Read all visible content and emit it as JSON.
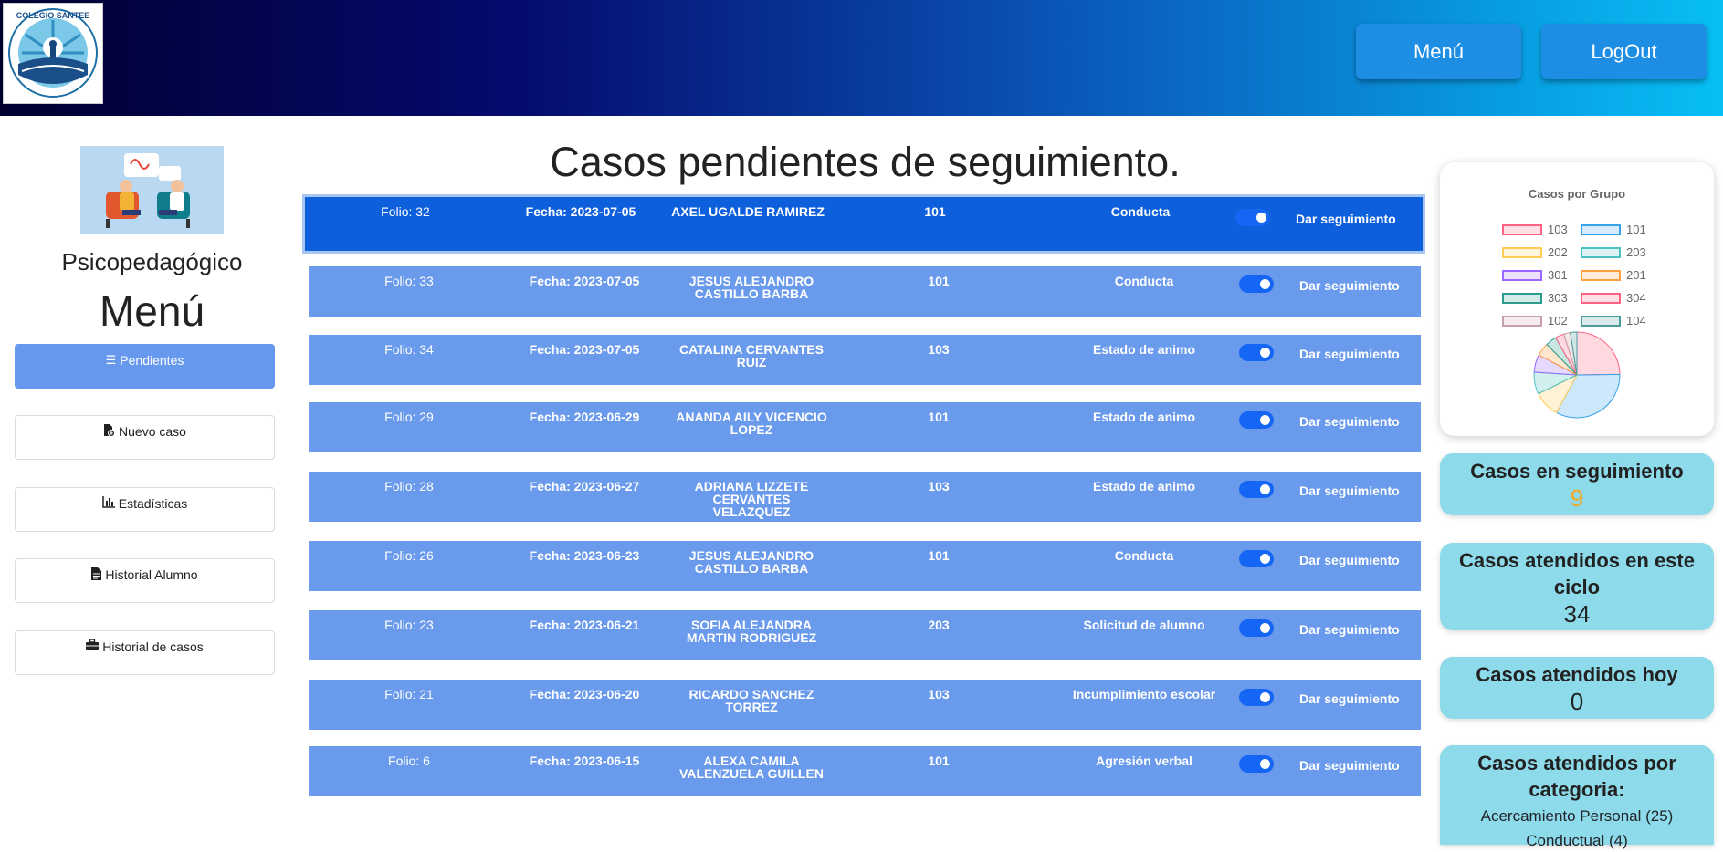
{
  "header": {
    "logo_text": "COLEGIO SANTEE",
    "menu_label": "Menú",
    "logout_label": "LogOut"
  },
  "sidebar": {
    "caption": "Psicopedagógico",
    "title": "Menú",
    "items": [
      {
        "label": "Pendientes",
        "icon": "bars-icon"
      },
      {
        "label": "Nuevo caso",
        "icon": "file-plus-icon"
      },
      {
        "label": "Estadísticas",
        "icon": "bar-chart-icon"
      },
      {
        "label": "Historial Alumno",
        "icon": "file-icon"
      },
      {
        "label": "Historial de casos",
        "icon": "briefcase-icon"
      }
    ]
  },
  "main": {
    "title": "Casos pendientes de seguimiento.",
    "action_label": "Dar seguimiento",
    "cases": [
      {
        "folio": "Folio: 32",
        "fecha": "Fecha: 2023-07-05",
        "name": "AXEL UGALDE RAMIREZ",
        "group": "101",
        "category": "Conducta",
        "active": true
      },
      {
        "folio": "Folio: 33",
        "fecha": "Fecha: 2023-07-05",
        "name": "JESUS ALEJANDRO CASTILLO BARBA",
        "group": "101",
        "category": "Conducta",
        "active": true
      },
      {
        "folio": "Folio: 34",
        "fecha": "Fecha: 2023-07-05",
        "name": "CATALINA CERVANTES RUIZ",
        "group": "103",
        "category": "Estado de animo",
        "active": true
      },
      {
        "folio": "Folio: 29",
        "fecha": "Fecha: 2023-06-29",
        "name": "ANANDA AILY VICENCIO LOPEZ",
        "group": "101",
        "category": "Estado de animo",
        "active": true
      },
      {
        "folio": "Folio: 28",
        "fecha": "Fecha: 2023-06-27",
        "name": "ADRIANA LIZZETE CERVANTES VELAZQUEZ",
        "group": "103",
        "category": "Estado de animo",
        "active": true
      },
      {
        "folio": "Folio: 26",
        "fecha": "Fecha: 2023-06-23",
        "name": "JESUS ALEJANDRO CASTILLO BARBA",
        "group": "101",
        "category": "Conducta",
        "active": true
      },
      {
        "folio": "Folio: 23",
        "fecha": "Fecha: 2023-06-21",
        "name": "SOFIA ALEJANDRA MARTIN RODRIGUEZ",
        "group": "203",
        "category": "Solicitud de alumno",
        "active": true
      },
      {
        "folio": "Folio: 21",
        "fecha": "Fecha: 2023-06-20",
        "name": "RICARDO SANCHEZ TORREZ",
        "group": "103",
        "category": "Incumplimiento escolar",
        "active": true
      },
      {
        "folio": "Folio: 6",
        "fecha": "Fecha: 2023-06-15",
        "name": "ALEXA CAMILA VALENZUELA GUILLEN",
        "group": "101",
        "category": "Agresión verbal",
        "active": true
      }
    ]
  },
  "chart_data": {
    "type": "pie",
    "title": "Casos por Grupo",
    "legend_position": "top",
    "series": [
      {
        "name": "103",
        "value": 3,
        "color": "#ff6384"
      },
      {
        "name": "101",
        "value": 4,
        "color": "#36a2eb"
      },
      {
        "name": "202",
        "value": 1.2,
        "color": "#ffcd56"
      },
      {
        "name": "203",
        "value": 1,
        "color": "#4bc0c0"
      },
      {
        "name": "301",
        "value": 0.8,
        "color": "#9966ff"
      },
      {
        "name": "201",
        "value": 0.6,
        "color": "#ff9f40"
      },
      {
        "name": "303",
        "value": 0.5,
        "color": "#2a9d8f"
      },
      {
        "name": "304",
        "value": 0.4,
        "color": "#ff6384"
      },
      {
        "name": "102",
        "value": 0.3,
        "color": "#c9a0a8"
      },
      {
        "name": "104",
        "value": 0.3,
        "color": "#4b9c9c"
      }
    ]
  },
  "stats": {
    "seguimiento_label": "Casos en seguimiento",
    "seguimiento_value": "9",
    "ciclo_label": "Casos atendidos en este ciclo",
    "ciclo_value": "34",
    "hoy_label": "Casos atendidos hoy",
    "hoy_value": "0",
    "categoria_label": "Casos atendidos por categoria:",
    "categorias": [
      "Acercamiento Personal (25)",
      "Conductual (4)"
    ]
  },
  "colors": {
    "accent_value": "#f5a623",
    "selected_row": "#0d5fdc",
    "row": "#6a9aec",
    "stat_card": "#8ddbea"
  }
}
